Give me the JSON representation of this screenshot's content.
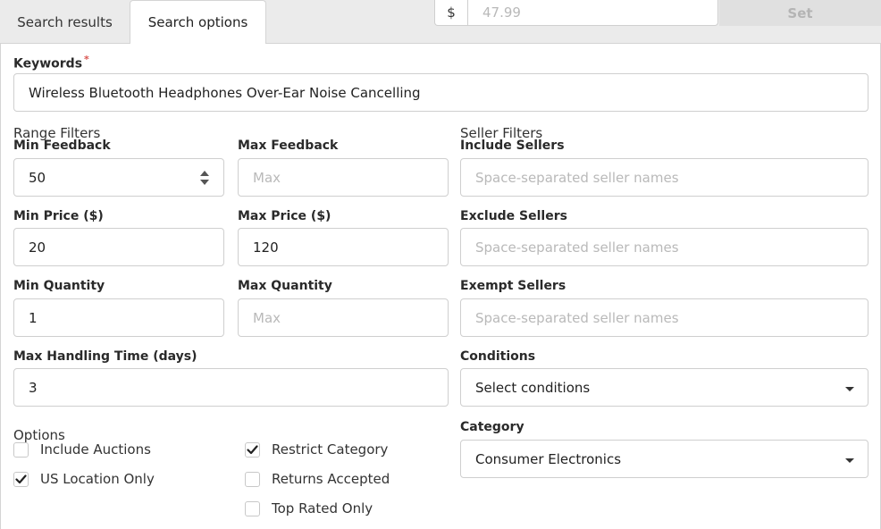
{
  "tabs": [
    {
      "label": "Search results",
      "active": false
    },
    {
      "label": "Search options",
      "active": true
    }
  ],
  "price_bar": {
    "currency_symbol": "$",
    "placeholder": "47.99",
    "set_label": "Set"
  },
  "keywords": {
    "label": "Keywords",
    "required_mark": "*",
    "value": "Wireless Bluetooth Headphones Over-Ear Noise Cancelling"
  },
  "range_filters": {
    "title": "Range Filters",
    "min_feedback": {
      "label": "Min Feedback",
      "value": "50"
    },
    "max_feedback": {
      "label": "Max Feedback",
      "placeholder": "Max"
    },
    "min_price": {
      "label": "Min Price ($)",
      "value": "20"
    },
    "max_price": {
      "label": "Max Price ($)",
      "value": "120"
    },
    "min_quantity": {
      "label": "Min Quantity",
      "value": "1"
    },
    "max_quantity": {
      "label": "Max Quantity",
      "placeholder": "Max"
    },
    "max_handling": {
      "label": "Max Handling Time (days)",
      "value": "3"
    }
  },
  "seller_filters": {
    "title": "Seller Filters",
    "include": {
      "label": "Include Sellers",
      "placeholder": "Space-separated seller names"
    },
    "exclude": {
      "label": "Exclude Sellers",
      "placeholder": "Space-separated seller names"
    },
    "exempt": {
      "label": "Exempt Sellers",
      "placeholder": "Space-separated seller names"
    }
  },
  "conditions": {
    "label": "Conditions",
    "value": "Select conditions"
  },
  "category": {
    "label": "Category",
    "value": "Consumer Electronics"
  },
  "options": {
    "title": "Options",
    "items": [
      {
        "label": "Include Auctions",
        "checked": false
      },
      {
        "label": "US Location Only",
        "checked": true
      },
      {
        "label": "Restrict Category",
        "checked": true
      },
      {
        "label": "Returns Accepted",
        "checked": false
      },
      {
        "label": "Top Rated Only",
        "checked": false
      }
    ]
  },
  "icons": {
    "spinner": "number-spinner-icon",
    "dropdown": "caret-down-icon",
    "check": "checkmark-icon"
  },
  "colors": {
    "required": "#d9534f",
    "border": "#cfcfcf",
    "placeholder": "#b9b9b9",
    "background": "#ebebeb"
  }
}
